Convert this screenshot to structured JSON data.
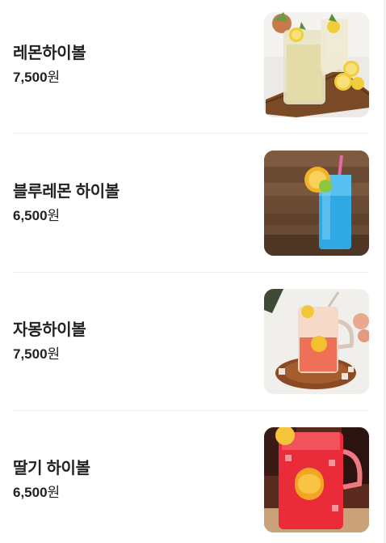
{
  "menu": {
    "currency_suffix": "원",
    "items": [
      {
        "name": "레몬하이볼",
        "price": "7,500",
        "image": "lemon-highball-photo"
      },
      {
        "name": "블루레몬 하이볼",
        "price": "6,500",
        "image": "blue-lemon-highball-photo"
      },
      {
        "name": "자몽하이볼",
        "price": "7,500",
        "image": "grapefruit-highball-photo"
      },
      {
        "name": "딸기 하이볼",
        "price": "6,500",
        "image": "strawberry-highball-photo"
      }
    ]
  }
}
